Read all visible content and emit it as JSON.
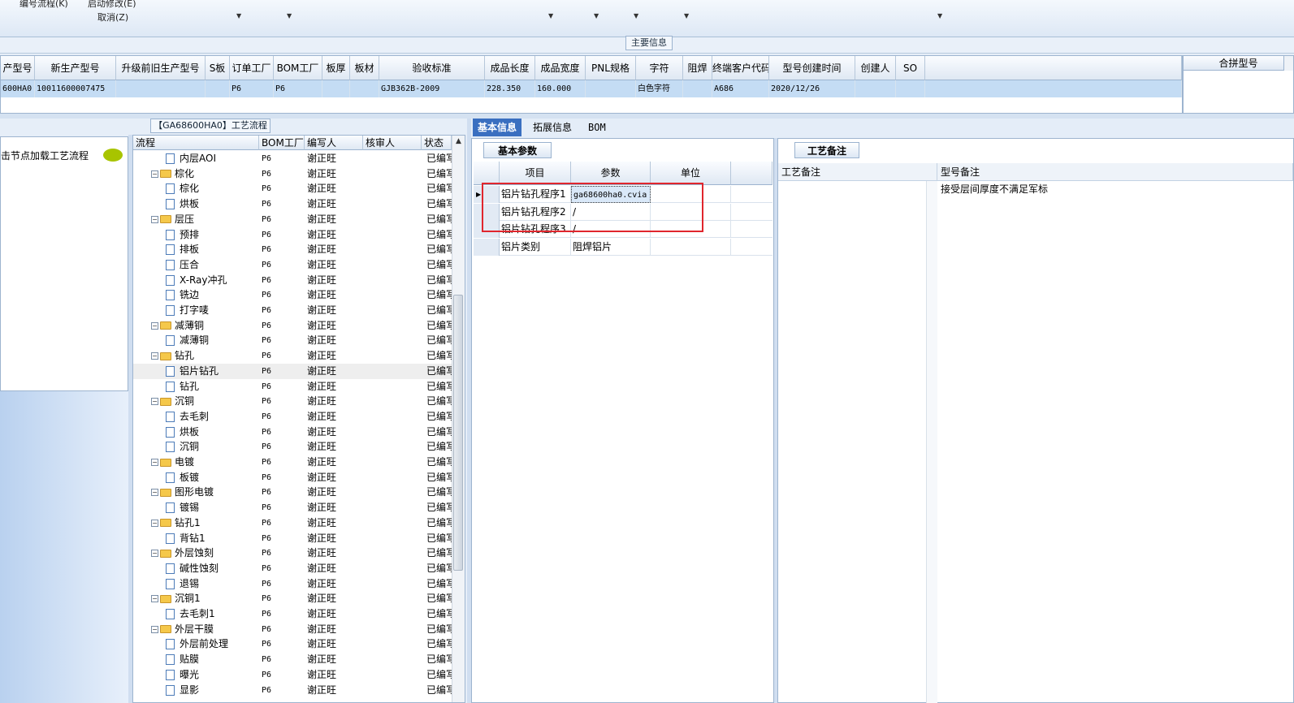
{
  "toolbar": {
    "items": [
      "编号流程(K)",
      "启动修改(E)",
      "取消(Z)"
    ]
  },
  "main_info": {
    "title": "主要信息",
    "columns": [
      "产型号",
      "新生产型号",
      "升级前旧生产型号",
      "S板",
      "订单工厂",
      "BOM工厂",
      "板厚",
      "板材",
      "验收标准",
      "成品长度",
      "成品宽度",
      "PNL规格",
      "字符",
      "阻焊",
      "终端客户代码",
      "型号创建时间",
      "创建人",
      "SO"
    ],
    "row": [
      "600HA0",
      "10011600007475",
      "",
      "",
      "P6",
      "P6",
      "",
      "",
      "GJB362B-2009",
      "228.350",
      "160.000",
      "",
      "白色字符",
      "",
      "A686",
      "2020/12/26",
      "",
      ""
    ],
    "combine_header": "合拼型号"
  },
  "left_panel": {
    "hint": "击节点加载工艺流程"
  },
  "process_tree": {
    "title": "【GA68600HA0】工艺流程",
    "columns": [
      "流程",
      "BOM工厂",
      "编写人",
      "核审人",
      "状态"
    ],
    "rows": [
      {
        "name": "内层AOI",
        "level": 2,
        "bom": "P6",
        "writer": "谢正旺",
        "status": "已编写"
      },
      {
        "name": "棕化",
        "level": 1,
        "bom": "P6",
        "writer": "谢正旺",
        "status": "已编写"
      },
      {
        "name": "棕化",
        "level": 2,
        "bom": "P6",
        "writer": "谢正旺",
        "status": "已编写"
      },
      {
        "name": "烘板",
        "level": 2,
        "bom": "P6",
        "writer": "谢正旺",
        "status": "已编写"
      },
      {
        "name": "层压",
        "level": 1,
        "bom": "P6",
        "writer": "谢正旺",
        "status": "已编写"
      },
      {
        "name": "预排",
        "level": 2,
        "bom": "P6",
        "writer": "谢正旺",
        "status": "已编写"
      },
      {
        "name": "排板",
        "level": 2,
        "bom": "P6",
        "writer": "谢正旺",
        "status": "已编写"
      },
      {
        "name": "压合",
        "level": 2,
        "bom": "P6",
        "writer": "谢正旺",
        "status": "已编写"
      },
      {
        "name": "X-Ray冲孔",
        "level": 2,
        "bom": "P6",
        "writer": "谢正旺",
        "status": "已编写"
      },
      {
        "name": "铣边",
        "level": 2,
        "bom": "P6",
        "writer": "谢正旺",
        "status": "已编写"
      },
      {
        "name": "打字唛",
        "level": 2,
        "bom": "P6",
        "writer": "谢正旺",
        "status": "已编写"
      },
      {
        "name": "减薄铜",
        "level": 1,
        "bom": "P6",
        "writer": "谢正旺",
        "status": "已编写"
      },
      {
        "name": "减薄铜",
        "level": 2,
        "bom": "P6",
        "writer": "谢正旺",
        "status": "已编写"
      },
      {
        "name": "钻孔",
        "level": 1,
        "bom": "P6",
        "writer": "谢正旺",
        "status": "已编写"
      },
      {
        "name": "铝片钻孔",
        "level": 2,
        "bom": "P6",
        "writer": "谢正旺",
        "status": "已编写",
        "selected": true
      },
      {
        "name": "钻孔",
        "level": 2,
        "bom": "P6",
        "writer": "谢正旺",
        "status": "已编写"
      },
      {
        "name": "沉铜",
        "level": 1,
        "bom": "P6",
        "writer": "谢正旺",
        "status": "已编写"
      },
      {
        "name": "去毛刺",
        "level": 2,
        "bom": "P6",
        "writer": "谢正旺",
        "status": "已编写"
      },
      {
        "name": "烘板",
        "level": 2,
        "bom": "P6",
        "writer": "谢正旺",
        "status": "已编写"
      },
      {
        "name": "沉铜",
        "level": 2,
        "bom": "P6",
        "writer": "谢正旺",
        "status": "已编写"
      },
      {
        "name": "电镀",
        "level": 1,
        "bom": "P6",
        "writer": "谢正旺",
        "status": "已编写"
      },
      {
        "name": "板镀",
        "level": 2,
        "bom": "P6",
        "writer": "谢正旺",
        "status": "已编写"
      },
      {
        "name": "图形电镀",
        "level": 1,
        "bom": "P6",
        "writer": "谢正旺",
        "status": "已编写"
      },
      {
        "name": "镀锡",
        "level": 2,
        "bom": "P6",
        "writer": "谢正旺",
        "status": "已编写"
      },
      {
        "name": "钻孔1",
        "level": 1,
        "bom": "P6",
        "writer": "谢正旺",
        "status": "已编写"
      },
      {
        "name": "背钻1",
        "level": 2,
        "bom": "P6",
        "writer": "谢正旺",
        "status": "已编写"
      },
      {
        "name": "外层蚀刻",
        "level": 1,
        "bom": "P6",
        "writer": "谢正旺",
        "status": "已编写"
      },
      {
        "name": "碱性蚀刻",
        "level": 2,
        "bom": "P6",
        "writer": "谢正旺",
        "status": "已编写"
      },
      {
        "name": "退锡",
        "level": 2,
        "bom": "P6",
        "writer": "谢正旺",
        "status": "已编写"
      },
      {
        "name": "沉铜1",
        "level": 1,
        "bom": "P6",
        "writer": "谢正旺",
        "status": "已编写"
      },
      {
        "name": "去毛刺1",
        "level": 2,
        "bom": "P6",
        "writer": "谢正旺",
        "status": "已编写"
      },
      {
        "name": "外层干膜",
        "level": 1,
        "bom": "P6",
        "writer": "谢正旺",
        "status": "已编写"
      },
      {
        "name": "外层前处理",
        "level": 2,
        "bom": "P6",
        "writer": "谢正旺",
        "status": "已编写"
      },
      {
        "name": "贴膜",
        "level": 2,
        "bom": "P6",
        "writer": "谢正旺",
        "status": "已编写"
      },
      {
        "name": "曝光",
        "level": 2,
        "bom": "P6",
        "writer": "谢正旺",
        "status": "已编写"
      },
      {
        "name": "显影",
        "level": 2,
        "bom": "P6",
        "writer": "谢正旺",
        "status": "已编写"
      }
    ]
  },
  "detail_tabs": [
    "基本信息",
    "拓展信息",
    "BOM"
  ],
  "basic_params": {
    "subtab": "基本参数",
    "columns": [
      "项目",
      "参数",
      "单位"
    ],
    "rows": [
      {
        "item": "铝片钻孔程序1",
        "value": "ga68600ha0.cvia",
        "unit": ""
      },
      {
        "item": "铝片钻孔程序2",
        "value": "/",
        "unit": ""
      },
      {
        "item": "铝片钻孔程序3",
        "value": "/",
        "unit": ""
      },
      {
        "item": "铝片类别",
        "value": "阻焊铝片",
        "unit": ""
      }
    ]
  },
  "remarks": {
    "subtab": "工艺备注",
    "col_process": "工艺备注",
    "col_model": "型号备注",
    "model_text": "接受层间厚度不满足军标"
  },
  "colors": {
    "accent": "#3a6fc0",
    "highlight": "#e0262d",
    "selected_row": "#c4dcf4"
  }
}
